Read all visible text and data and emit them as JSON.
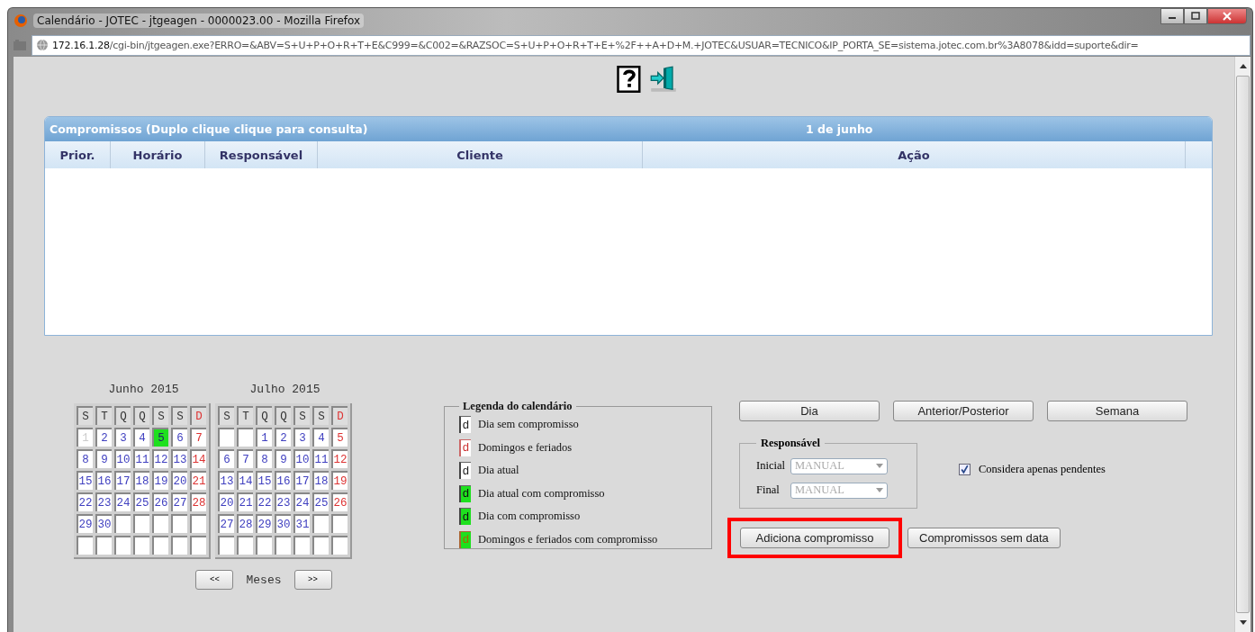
{
  "window": {
    "title": "Calendário - JOTEC - jtgeagen - 0000023.00 - Mozilla Firefox"
  },
  "address_bar": {
    "host": "172.16.1.28",
    "path": "/cgi-bin/jtgeagen.exe?ERRO=&ABV=S+U+P+O+R+T+E&C999=&C002=&RAZSOC=S+U+P+O+R+T+E+%2F++A+D+M.+JOTEC&USUAR=TECNICO&IP_PORTA_SE=sistema.jotec.com.br%3A8078&idd=suporte&dir="
  },
  "appointments": {
    "title": "Compromissos (Duplo clique clique para consulta)",
    "date": "1 de junho",
    "columns": [
      "Prior.",
      "Horário",
      "Responsável",
      "Cliente",
      "Ação"
    ]
  },
  "months": [
    {
      "title": "Junho 2015",
      "weekdays": [
        {
          "t": "S",
          "kind": "day"
        },
        {
          "t": "T",
          "kind": "day"
        },
        {
          "t": "Q",
          "kind": "day"
        },
        {
          "t": "Q",
          "kind": "day"
        },
        {
          "t": "S",
          "kind": "day"
        },
        {
          "t": "S",
          "kind": "day"
        },
        {
          "t": "D",
          "kind": "sunday"
        }
      ],
      "weeks": [
        [
          {
            "d": "1",
            "kind": "past"
          },
          {
            "d": "2",
            "kind": "day"
          },
          {
            "d": "3",
            "kind": "day"
          },
          {
            "d": "4",
            "kind": "day"
          },
          {
            "d": "5",
            "kind": "appt"
          },
          {
            "d": "6",
            "kind": "day"
          },
          {
            "d": "7",
            "kind": "sunday"
          }
        ],
        [
          {
            "d": "8",
            "kind": "day"
          },
          {
            "d": "9",
            "kind": "day"
          },
          {
            "d": "10",
            "kind": "day"
          },
          {
            "d": "11",
            "kind": "day"
          },
          {
            "d": "12",
            "kind": "day"
          },
          {
            "d": "13",
            "kind": "day"
          },
          {
            "d": "14",
            "kind": "sunday"
          }
        ],
        [
          {
            "d": "15",
            "kind": "day"
          },
          {
            "d": "16",
            "kind": "day"
          },
          {
            "d": "17",
            "kind": "day"
          },
          {
            "d": "18",
            "kind": "day"
          },
          {
            "d": "19",
            "kind": "day"
          },
          {
            "d": "20",
            "kind": "day"
          },
          {
            "d": "21",
            "kind": "sunday"
          }
        ],
        [
          {
            "d": "22",
            "kind": "day"
          },
          {
            "d": "23",
            "kind": "day"
          },
          {
            "d": "24",
            "kind": "day"
          },
          {
            "d": "25",
            "kind": "day"
          },
          {
            "d": "26",
            "kind": "day"
          },
          {
            "d": "27",
            "kind": "day"
          },
          {
            "d": "28",
            "kind": "sunday"
          }
        ],
        [
          {
            "d": "29",
            "kind": "day"
          },
          {
            "d": "30",
            "kind": "day"
          },
          {
            "kind": "empty"
          },
          {
            "kind": "empty"
          },
          {
            "kind": "empty"
          },
          {
            "kind": "empty"
          },
          {
            "kind": "empty"
          }
        ],
        [
          {
            "kind": "empty"
          },
          {
            "kind": "empty"
          },
          {
            "kind": "empty"
          },
          {
            "kind": "empty"
          },
          {
            "kind": "empty"
          },
          {
            "kind": "empty"
          },
          {
            "kind": "empty"
          }
        ]
      ]
    },
    {
      "title": "Julho 2015",
      "weekdays": [
        {
          "t": "S",
          "kind": "day"
        },
        {
          "t": "T",
          "kind": "day"
        },
        {
          "t": "Q",
          "kind": "day"
        },
        {
          "t": "Q",
          "kind": "day"
        },
        {
          "t": "S",
          "kind": "day"
        },
        {
          "t": "S",
          "kind": "day"
        },
        {
          "t": "D",
          "kind": "sunday"
        }
      ],
      "weeks": [
        [
          {
            "kind": "empty"
          },
          {
            "kind": "empty"
          },
          {
            "d": "1",
            "kind": "day"
          },
          {
            "d": "2",
            "kind": "day"
          },
          {
            "d": "3",
            "kind": "day"
          },
          {
            "d": "4",
            "kind": "day"
          },
          {
            "d": "5",
            "kind": "sunday"
          }
        ],
        [
          {
            "d": "6",
            "kind": "day"
          },
          {
            "d": "7",
            "kind": "day"
          },
          {
            "d": "8",
            "kind": "day"
          },
          {
            "d": "9",
            "kind": "day"
          },
          {
            "d": "10",
            "kind": "day"
          },
          {
            "d": "11",
            "kind": "day"
          },
          {
            "d": "12",
            "kind": "sunday"
          }
        ],
        [
          {
            "d": "13",
            "kind": "day"
          },
          {
            "d": "14",
            "kind": "day"
          },
          {
            "d": "15",
            "kind": "day"
          },
          {
            "d": "16",
            "kind": "day"
          },
          {
            "d": "17",
            "kind": "day"
          },
          {
            "d": "18",
            "kind": "day"
          },
          {
            "d": "19",
            "kind": "sunday"
          }
        ],
        [
          {
            "d": "20",
            "kind": "day"
          },
          {
            "d": "21",
            "kind": "day"
          },
          {
            "d": "22",
            "kind": "day"
          },
          {
            "d": "23",
            "kind": "day"
          },
          {
            "d": "24",
            "kind": "day"
          },
          {
            "d": "25",
            "kind": "day"
          },
          {
            "d": "26",
            "kind": "sunday"
          }
        ],
        [
          {
            "d": "27",
            "kind": "day"
          },
          {
            "d": "28",
            "kind": "day"
          },
          {
            "d": "29",
            "kind": "day"
          },
          {
            "d": "30",
            "kind": "day"
          },
          {
            "d": "31",
            "kind": "day"
          },
          {
            "kind": "empty"
          },
          {
            "kind": "empty"
          }
        ],
        [
          {
            "kind": "empty"
          },
          {
            "kind": "empty"
          },
          {
            "kind": "empty"
          },
          {
            "kind": "empty"
          },
          {
            "kind": "empty"
          },
          {
            "kind": "empty"
          },
          {
            "kind": "empty"
          }
        ]
      ]
    }
  ],
  "month_nav": {
    "prev": "<<",
    "label": "Meses",
    "next": ">>"
  },
  "legend": {
    "title": "Legenda do calendário",
    "items": [
      {
        "mark": "d",
        "kind": "plain",
        "label": "Dia sem compromisso"
      },
      {
        "mark": "d",
        "kind": "holiday",
        "label": "Domingos e feriados"
      },
      {
        "mark": "d",
        "kind": "plain",
        "label": "Dia atual"
      },
      {
        "mark": "d",
        "kind": "appt",
        "label": "Dia atual com compromisso"
      },
      {
        "mark": "d",
        "kind": "appt",
        "label": "Dia com compromisso"
      },
      {
        "mark": "d",
        "kind": "holiday_appt",
        "label": "Domingos e feriados com compromisso"
      }
    ]
  },
  "view_buttons": [
    "Dia",
    "Anterior/Posterior",
    "Semana"
  ],
  "responsible": {
    "title": "Responsável",
    "fields": [
      {
        "label": "Inicial",
        "value": "MANUAL",
        "disabled": true
      },
      {
        "label": "Final",
        "value": "MANUAL",
        "disabled": true
      }
    ]
  },
  "pending_only": {
    "label": "Considera apenas pendentes",
    "checked": true
  },
  "actions": [
    {
      "label": "Adiciona compromisso",
      "highlighted": true
    },
    {
      "label": "Compromissos sem data",
      "highlighted": false
    }
  ]
}
